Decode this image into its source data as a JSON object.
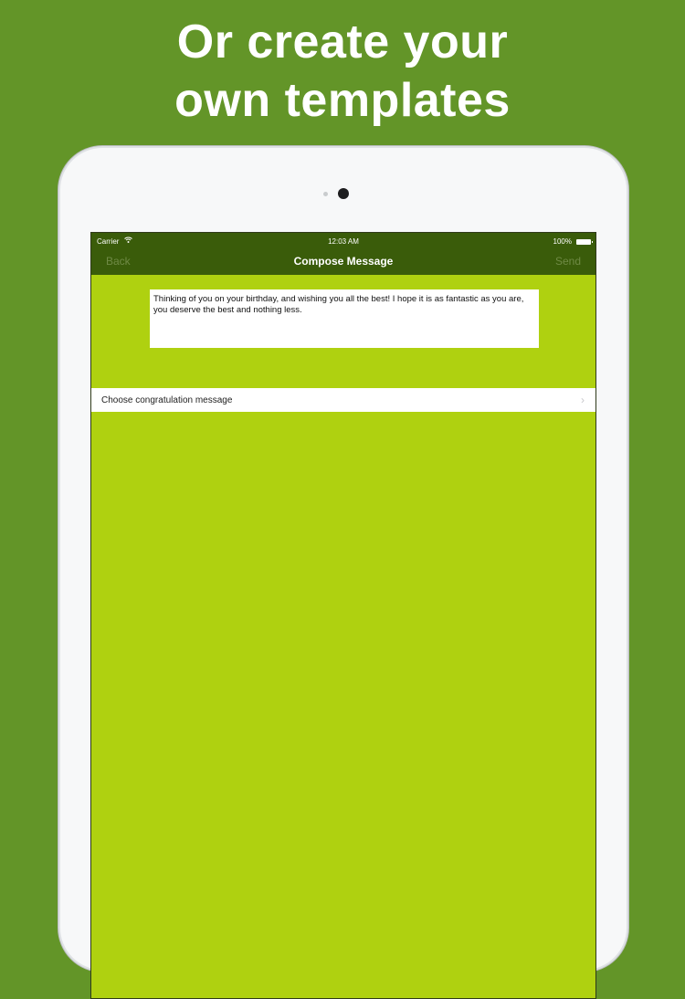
{
  "promo": {
    "headline_line1": "Or create your",
    "headline_line2": "own templates"
  },
  "status_bar": {
    "carrier": "Carrier",
    "time": "12:03 AM",
    "battery": "100%"
  },
  "nav": {
    "back_label": "Back",
    "title": "Compose Message",
    "send_label": "Send"
  },
  "message": {
    "text": "Thinking of you on your birthday, and wishing you all the best! I hope it is as fantastic as you are, you deserve the best and nothing less."
  },
  "list": {
    "choose_label": "Choose congratulation message"
  },
  "colors": {
    "background": "#639528",
    "navbar": "#3a5c0a",
    "content": "#afd110"
  },
  "icons": [
    "wifi-icon",
    "battery-icon",
    "chevron-right-icon"
  ]
}
